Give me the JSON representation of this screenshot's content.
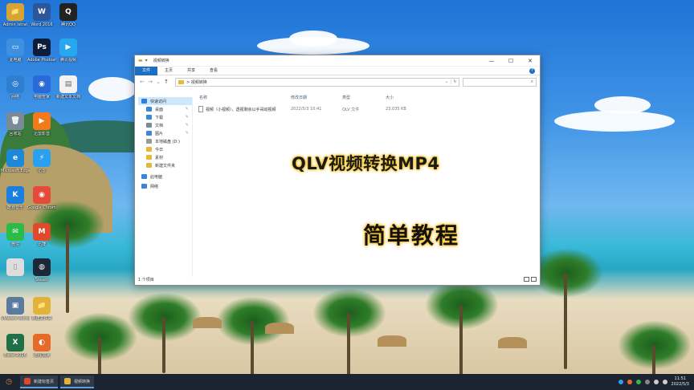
{
  "desktop": {
    "icons": [
      {
        "label": "Admin istrat",
        "glyph": "📁",
        "color": "#d6a436"
      },
      {
        "label": "Word 2016",
        "glyph": "W",
        "color": "#2b579a"
      },
      {
        "label": "腾讯QQ",
        "glyph": "Q",
        "color": "#222222"
      },
      {
        "label": "此电脑",
        "glyph": "▭",
        "color": "#3d8fe0"
      },
      {
        "label": "Adobe Photosh..",
        "glyph": "Ps",
        "color": "#0b1d3a"
      },
      {
        "label": "腾讯视频",
        "glyph": "▶",
        "color": "#26a8f0"
      },
      {
        "label": "网络",
        "glyph": "◎",
        "color": "#2f7fd0"
      },
      {
        "label": "电脑管家",
        "glyph": "◉",
        "color": "#2a69d8"
      },
      {
        "label": "新建文本文档",
        "glyph": "▤",
        "color": "#f2f2f2"
      },
      {
        "label": "回收站",
        "glyph": "🗑",
        "color": "#7a8a99"
      },
      {
        "label": "迅雷影音",
        "glyph": "▶",
        "color": "#f27a1a"
      },
      {
        "label": "Microsoft Edge",
        "glyph": "e",
        "color": "#1e88d8"
      },
      {
        "label": "迅雷",
        "glyph": "⚡",
        "color": "#2aa0f0"
      },
      {
        "label": "酷狗音乐",
        "glyph": "K",
        "color": "#1b7fe0"
      },
      {
        "label": "Google Chrome",
        "glyph": "◉",
        "color": "#e54a3a"
      },
      {
        "label": "微信",
        "glyph": "✉",
        "color": "#2dbb48"
      },
      {
        "label": "迅捷",
        "glyph": "M",
        "color": "#e04a2a"
      },
      {
        "label": "",
        "glyph": "▯",
        "color": "#dddddd"
      },
      {
        "label": "Steam",
        "glyph": "◍",
        "color": "#1b2838"
      },
      {
        "label": "VMware Workstation",
        "glyph": "▣",
        "color": "#5a7aa0"
      },
      {
        "label": "新建文件夹",
        "glyph": "📁",
        "color": "#e0b43c"
      },
      {
        "label": "Excel 2016",
        "glyph": "X",
        "color": "#1f7145"
      },
      {
        "label": "游戏加速",
        "glyph": "◐",
        "color": "#e86a2a"
      }
    ]
  },
  "window": {
    "title": "视频转换",
    "ribbon": {
      "file": "文件",
      "home": "主页",
      "share": "共享",
      "view": "查看",
      "help": "?"
    },
    "controls": {
      "minimize": "—",
      "maximize": "☐",
      "close": "✕"
    },
    "address": {
      "path": "> 视频转换",
      "refresh": "↻",
      "dropdown": "⌄"
    },
    "search": {
      "icon": "⌕"
    },
    "nav": {
      "back": "←",
      "forward": "→",
      "up_dd": "⌄",
      "up": "↑",
      "items": [
        {
          "label": "快速访问",
          "icon_color": "#2d7fe0",
          "pin": ""
        },
        {
          "label": "桌面",
          "icon_color": "#3a86d8",
          "pin": "✎"
        },
        {
          "label": "下载",
          "icon_color": "#3a86d8",
          "pin": "✎"
        },
        {
          "label": "文档",
          "icon_color": "#7a8a99",
          "pin": "✎"
        },
        {
          "label": "图片",
          "icon_color": "#3a86d8",
          "pin": "✎"
        },
        {
          "label": "本地磁盘 (D:)",
          "icon_color": "#999999",
          "pin": ""
        },
        {
          "label": "今日",
          "icon_color": "#e6b939",
          "pin": ""
        },
        {
          "label": "素材",
          "icon_color": "#e6b939",
          "pin": ""
        },
        {
          "label": "新建文件夹",
          "icon_color": "#e6b939",
          "pin": ""
        },
        {
          "label": "此电脑",
          "icon_color": "#3a86d8",
          "pin": ""
        },
        {
          "label": "网络",
          "icon_color": "#3a86d8",
          "pin": ""
        }
      ]
    },
    "columns": {
      "name": "名称",
      "date": "修改日期",
      "type": "类型",
      "size": "大小",
      "sort": "^"
    },
    "files": [
      {
        "name": "视频（小视频），透视剩余以手哥动视频",
        "date": "2022/5/3 10:41",
        "type": "QLV 文件",
        "size": "23,035 KB"
      }
    ],
    "status": {
      "count": "1 个项目"
    }
  },
  "overlay": {
    "title": "QLV视频转换MP4",
    "subtitle": "简单教程"
  },
  "taskbar": {
    "start_icon": "◷",
    "buttons": [
      {
        "label": "新建标签页",
        "icon_color": "#e04a2a"
      },
      {
        "label": "视频转换",
        "icon_color": "#e0b43c"
      }
    ],
    "clock_time": "11:51",
    "clock_date": "2022/5/3"
  }
}
